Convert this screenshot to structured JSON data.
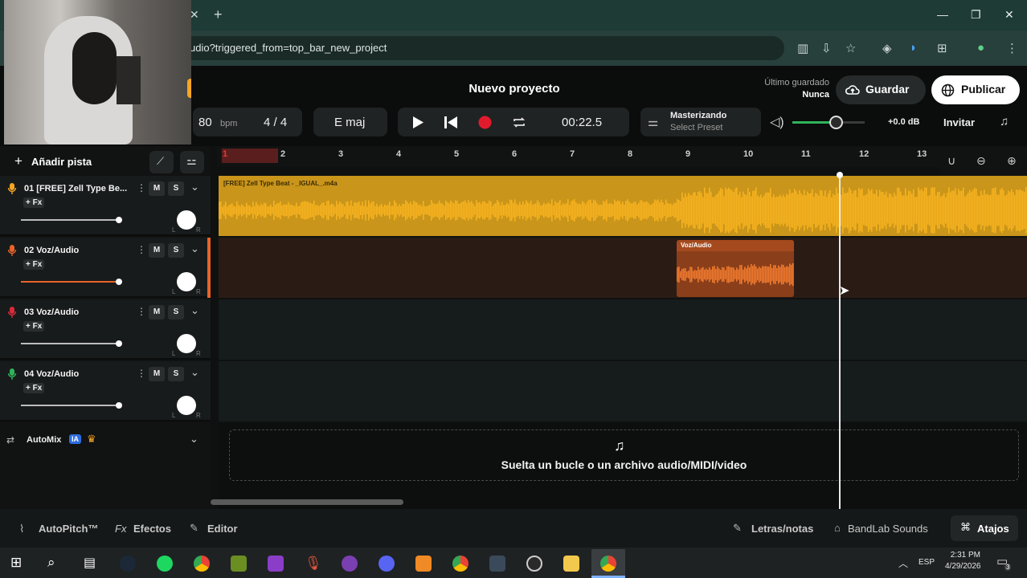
{
  "browser": {
    "url": "udio?triggered_from=top_bar_new_project",
    "tab_close": "✕",
    "new_tab": "+",
    "window_controls": {
      "minimize": "—",
      "maximize": "❐",
      "close": "✕"
    }
  },
  "header": {
    "title": "Nuevo proyecto",
    "last_saved_label": "Último guardado",
    "last_saved_value": "Nunca",
    "save_label": "Guardar",
    "publish_label": "Publicar"
  },
  "transport": {
    "bpm_value": "80",
    "bpm_unit": "bpm",
    "time_signature": "4 / 4",
    "key": "E maj",
    "time": "00:22.5",
    "mastering_label": "Masterizando",
    "mastering_preset": "Select Preset",
    "master_gain": "+0.0 dB",
    "invite_label": "Invitar",
    "master_volume_level": 0.6
  },
  "toolbar": {
    "add_track_label": "Añadir pista"
  },
  "tracks": [
    {
      "name": "01  [FREE] Zell Type Be...",
      "fx": "+ Fx",
      "mute": "M",
      "solo": "S",
      "color": "#f5a623",
      "volume": 1.0,
      "pan_l": "L",
      "pan_r": "R"
    },
    {
      "name": "02  Voz/Audio",
      "fx": "+ Fx",
      "mute": "M",
      "solo": "S",
      "color": "#e8632a",
      "volume": 1.0,
      "pan_l": "L",
      "pan_r": "R"
    },
    {
      "name": "03  Voz/Audio",
      "fx": "+ Fx",
      "mute": "M",
      "solo": "S",
      "color": "#d92b3a",
      "volume": 1.0,
      "pan_l": "L",
      "pan_r": "R"
    },
    {
      "name": "04  Voz/Audio",
      "fx": "+ Fx",
      "mute": "M",
      "solo": "S",
      "color": "#2fb35a",
      "volume": 1.0,
      "pan_l": "L",
      "pan_r": "R"
    }
  ],
  "automix": {
    "label": "AutoMix",
    "badge": "IA"
  },
  "ruler": {
    "bars": [
      "1",
      "2",
      "3",
      "4",
      "5",
      "6",
      "7",
      "8",
      "9",
      "10",
      "11",
      "12",
      "13"
    ]
  },
  "clips": {
    "beat_label": "[FREE] Zell Type Beat - _IGUAL_.m4a",
    "voice_label": "Voz/Audio"
  },
  "dropzone": {
    "text": "Suelta un bucle o un archivo audio/MIDI/video"
  },
  "bottom": {
    "autopitch": "AutoPitch™",
    "fx_prefix": "Fx",
    "effects": "Efectos",
    "editor": "Editor",
    "lyrics": "Letras/notas",
    "sounds": "BandLab Sounds",
    "shortcuts": "Atajos"
  },
  "taskbar": {
    "lang": "ESP",
    "time": "2:31 PM",
    "date": "4/29/2026",
    "notifications": "3"
  }
}
